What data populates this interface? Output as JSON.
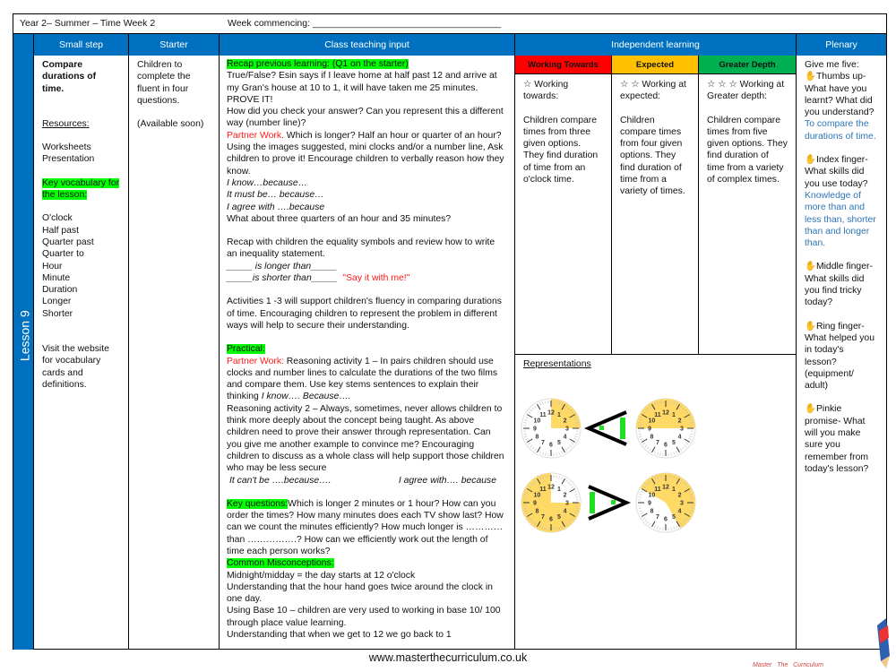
{
  "header": {
    "title": "Year 2– Summer – Time Week 2",
    "week_commencing": "Week commencing: ____________________________________"
  },
  "lesson_label": "Lesson 9",
  "columns": {
    "small_step": "Small step",
    "starter": "Starter",
    "class_teaching": "Class teaching input",
    "independent": "Independent learning",
    "plenary": "Plenary"
  },
  "small_step": {
    "title": "Compare durations of time.",
    "resources_label": "Resources:",
    "resources": [
      "Worksheets",
      "Presentation"
    ],
    "vocab_label": "Key vocabulary for the lesson:",
    "vocab": [
      "O'clock",
      "Half past",
      "Quarter past",
      "Quarter to",
      "Hour",
      "Minute",
      "Duration",
      "Longer",
      "Shorter"
    ],
    "website_note": "Visit the website for vocabulary cards and definitions."
  },
  "starter": {
    "text": "Children to complete the fluent in four questions.",
    "note": "(Available soon)"
  },
  "teaching": {
    "recap_label": "Recap previous learning: (Q1 on the starter)",
    "recap_text": "True/False?  Esin says if I leave home at half past 12 and arrive at my Gran's house at 10 to 1, it will have taken me 25 minutes. PROVE IT!",
    "check_text": "How did you check your answer?  Can you represent this a different way (number line)?",
    "partner_label": "Partner Work.",
    "partner_text": " Which is longer?  Half an hour or quarter of an hour? Using the images suggested,  mini clocks and/or a number line, Ask children to prove it!  Encourage children to verbally reason how they know.",
    "stems": [
      "I know…because…",
      "It must be… because…",
      "I agree with ….because"
    ],
    "three_quarters": "What about three quarters of an hour and 35 minutes?",
    "recap_symbols": "Recap with children the equality symbols and review how to write an inequality statement.",
    "longer_stem": "_____ is longer than_____",
    "shorter_stem": "_____is shorter than_____",
    "say_it": "\"Say it with me!\"",
    "activities": "Activities 1 -3 will support children's fluency in comparing durations of time.  Encouraging children to represent the problem in different ways will help to secure their understanding.",
    "practical_label": "Practical:",
    "practical_partner_label": "Partner Work:",
    "practical_text": " Reasoning activity 1 – In pairs children should use clocks and number lines to calculate the durations of the two films and compare them.  Use key stems sentences to explain their thinking ",
    "practical_stem": "I know…. Because….",
    "reasoning2": "Reasoning activity 2 – Always, sometimes, never allows children to think more deeply about the concept being taught. As above children need to prove their answer through representation.   Can you give me another example to convince me? Encouraging children to discuss as a whole class will help support those children who may be less secure",
    "stem_cant": "It can't be ….because….",
    "stem_agree": "I agree with…. because",
    "key_q_label": "Key questions:",
    "key_q_text": "Which is longer 2 minutes or 1 hour? How can you order the times? How many minutes does each TV show last? How can we count the minutes efficiently? How much longer is ………… than …………….? How can we efficiently work out the length of time each person works?",
    "misconceptions_label": "Common Misconceptions:",
    "misconceptions": [
      "Midnight/midday = the day starts at 12 o'clock",
      "Understanding that the hour hand goes twice around the clock in one day.",
      "Using Base 10 – children are very used to working in base 10/ 100 through place value learning.",
      "Understanding that when we get to 12 we go back to 1"
    ]
  },
  "independent": [
    {
      "label": "Working Towards",
      "color": "#ff0000",
      "stars": 1,
      "heading": "Working towards:",
      "text": "Children compare times from three given options. They find duration of time from an o'clock time."
    },
    {
      "label": "Expected",
      "color": "#ffc000",
      "stars": 2,
      "heading": "Working at expected:",
      "text": "Children compare times from four given options. They find duration of time from a variety of times."
    },
    {
      "label": "Greater Depth",
      "color": "#00b050",
      "stars": 3,
      "heading": "Working at Greater depth:",
      "text": "Children compare times from five given options. They find duration of time from a variety of complex times."
    }
  ],
  "representations": {
    "label": "Representations",
    "comparisons": [
      {
        "left_minutes": [
          0,
          15
        ],
        "symbol": "<",
        "right_minutes": [
          45,
          15
        ]
      },
      {
        "left_minutes": [
          15,
          60
        ],
        "symbol": ">",
        "right_minutes": [
          50,
          25
        ]
      }
    ]
  },
  "plenary": {
    "intro": "Give me five:",
    "items": [
      {
        "q": "Thumbs up- What have you learnt? What did you understand?",
        "a": "To compare the durations of time."
      },
      {
        "q": "Index finger- What skills did you use today?",
        "a": "Knowledge of more than and less than, shorter than and longer than."
      },
      {
        "q": "Middle finger- What skills did you find tricky today?",
        "a": ""
      },
      {
        "q": "Ring finger- What helped you in today's lesson? (equipment/ adult)",
        "a": ""
      },
      {
        "q": "Pinkie promise- What will you make sure you remember from today's lesson?",
        "a": ""
      }
    ]
  },
  "footer": {
    "url": "www.masterthecurriculum.co.uk",
    "logo": "Master The Curriculum"
  },
  "colors": {
    "header_blue": "#0070c0",
    "highlight": "#00ff00",
    "clock_fill": "#ffd966",
    "accent_red": "#ff1a1a",
    "accent_blue": "#2e75b6"
  }
}
